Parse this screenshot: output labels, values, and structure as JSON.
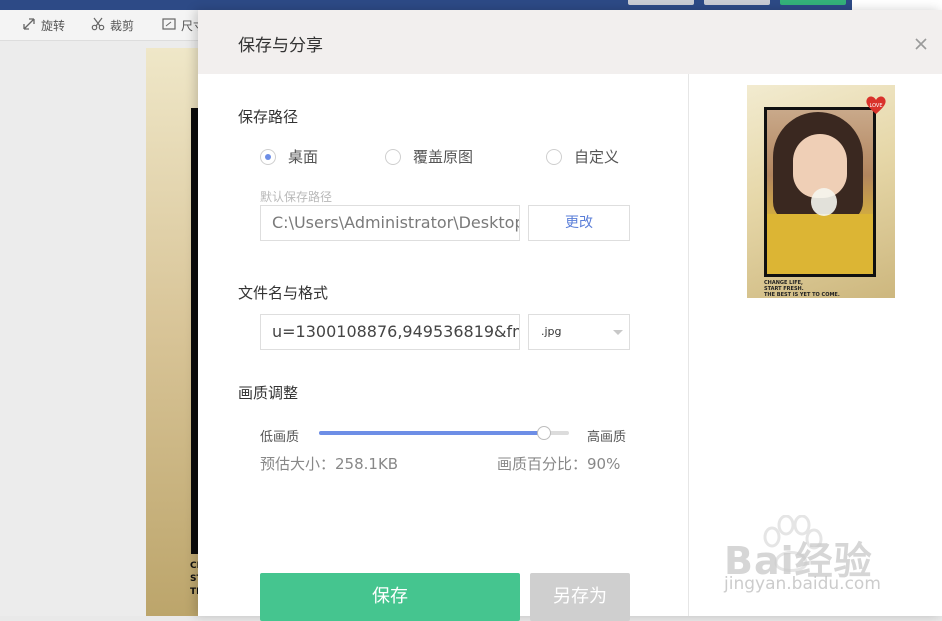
{
  "background": {
    "tools": [
      {
        "label": "旋转",
        "icon": "rotate-icon"
      },
      {
        "label": "裁剪",
        "icon": "scissors-icon"
      },
      {
        "label": "尺寸",
        "icon": "resize-icon"
      }
    ],
    "canvas_text": [
      "CH",
      "ST",
      "TH"
    ]
  },
  "dialog": {
    "title": "保存与分享",
    "close_icon": "close-icon",
    "save_path": {
      "title": "保存路径",
      "options": [
        {
          "label": "桌面",
          "checked": true
        },
        {
          "label": "覆盖原图",
          "checked": false
        },
        {
          "label": "自定义",
          "checked": false
        }
      ],
      "default_label": "默认保存路径",
      "path_value": "C:\\Users\\Administrator\\Desktop",
      "change_button": "更改"
    },
    "file": {
      "title": "文件名与格式",
      "name_value": "u=1300108876,949536819&fm...",
      "format_value": ".jpg"
    },
    "quality": {
      "title": "画质调整",
      "low_label": "低画质",
      "high_label": "高画质",
      "level": 0.9,
      "estimate_text": "预估大小：258.1KB",
      "percent_text": "画质百分比：90%"
    },
    "buttons": {
      "save": "保存",
      "save_as": "另存为"
    },
    "preview": {
      "caption_lines": [
        "CHANGE LIFE,",
        "START FRESH.",
        "THE BEST IS YET TO COME."
      ],
      "badge_text": "LOVE"
    }
  },
  "watermark": {
    "logo": "Bai经验",
    "url": "jingyan.baidu.com"
  },
  "colors": {
    "accent": "#6d8ee6",
    "save_green": "#45c58f",
    "topbar": "#2d4a86"
  }
}
